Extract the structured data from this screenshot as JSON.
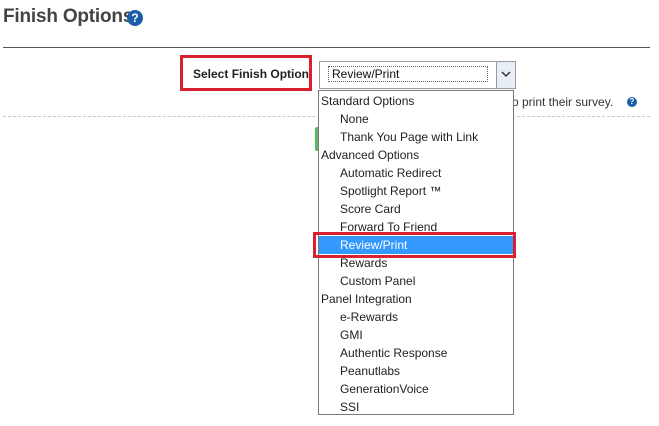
{
  "header": {
    "title": "Finish Options",
    "help_icon": "question-circle-icon"
  },
  "field": {
    "label": "Select Finish Option",
    "selected_value": "Review/Print",
    "dropdown_icon": "chevron-down-icon"
  },
  "background": {
    "description_fragment": "o print their survey.",
    "help_icon": "question-circle-icon"
  },
  "dropdown": {
    "groups": [
      {
        "label": "Standard Options",
        "options": [
          "None",
          "Thank You Page with Link"
        ]
      },
      {
        "label": "Advanced Options",
        "options": [
          "Automatic Redirect",
          "Spotlight Report ™",
          "Score Card",
          "Forward To Friend",
          "Review/Print",
          "Rewards",
          "Custom Panel"
        ]
      },
      {
        "label": "Panel Integration",
        "options": [
          "e-Rewards",
          "GMI",
          "Authentic Response",
          "Peanutlabs",
          "GenerationVoice",
          "SSI"
        ]
      }
    ],
    "highlighted_option": "Review/Print"
  },
  "colors": {
    "highlight_border": "#d9202e",
    "selection_bg": "#3399ff",
    "help_icon_bg": "#1a5ea8"
  }
}
